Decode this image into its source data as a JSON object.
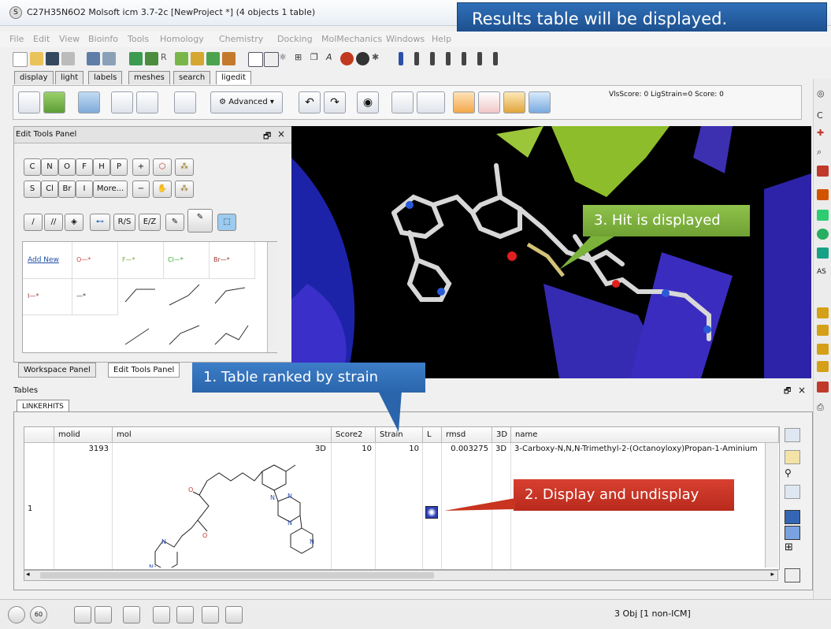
{
  "window": {
    "title": "C27H35N6O2 Molsoft icm 3.7-2c  [NewProject *] (4 objects 1 table)",
    "app_icon": "S"
  },
  "callouts": {
    "results": "Results table will be displayed.",
    "hit": "3. Hit is displayed",
    "strain": "1. Table ranked by strain",
    "display": "2. Display and undisplay"
  },
  "menu": [
    "File",
    "Edit",
    "View",
    "Bioinfo",
    "Tools",
    "Homology",
    "Chemistry",
    "Docking",
    "MolMechanics",
    "Windows",
    "Help"
  ],
  "panel_tabs": [
    "display",
    "light",
    "labels",
    "meshes",
    "search",
    "ligedit"
  ],
  "ligedit_toolbar": {
    "advanced_label": "Advanced",
    "score_text": "VlsScore: 0 LigStrain=0 Score: 0"
  },
  "edit_tools_panel": {
    "title": "Edit Tools Panel",
    "row1": [
      "C",
      "N",
      "O",
      "F",
      "H",
      "P"
    ],
    "row2": [
      "S",
      "Cl",
      "Br",
      "I",
      "More..."
    ],
    "rs_label": "R/S",
    "ez_label": "E/Z",
    "add_new": "Add New",
    "fragments": [
      "O—*",
      "F—*",
      "Cl—*",
      "Br—*",
      "I—*",
      "—*"
    ]
  },
  "workspace_tabs": [
    "Workspace Panel",
    "Edit Tools Panel"
  ],
  "tables": {
    "title": "Tables",
    "tab": "LINKERHITS",
    "columns": [
      "molid",
      "mol",
      "Score2",
      "Strain",
      "L",
      "rmsd",
      "3D",
      "name"
    ],
    "rows": [
      {
        "index": "1",
        "molid": "3193",
        "mol": "3D",
        "Score2": "10",
        "Strain": "10",
        "rmsd": "0.003275",
        "3D": "3D",
        "name": "3-Carboxy-N,N,N-Trimethyl-2-(Octanoyloxy)Propan-1-Aminium"
      }
    ]
  },
  "statusbar": {
    "objects": "3 Obj [1 non-ICM]",
    "zoom_badge": "60"
  },
  "colors": {
    "blue_callout": "#2a65ab",
    "green_callout": "#7bb23a",
    "red_callout": "#c8341f"
  }
}
